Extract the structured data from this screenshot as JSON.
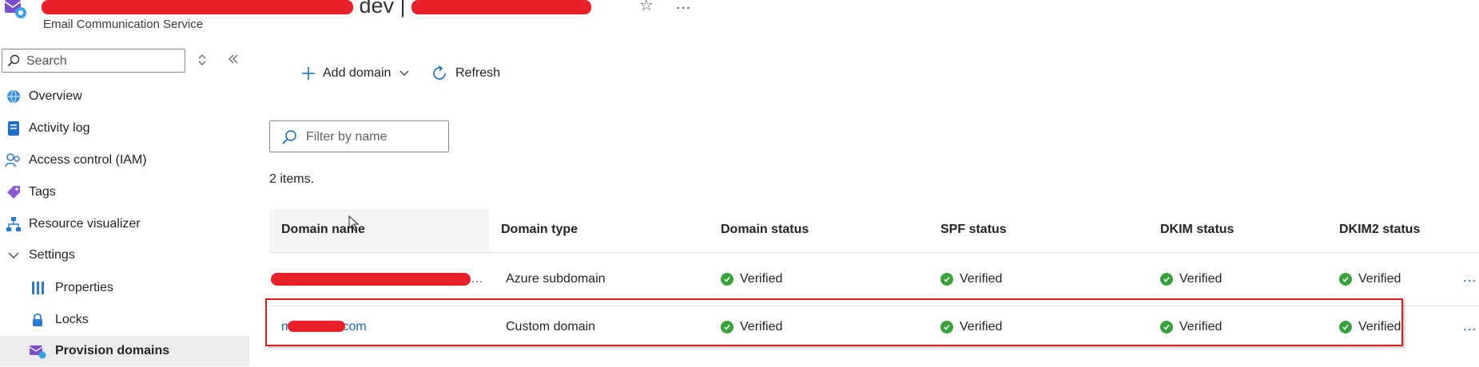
{
  "header": {
    "title_visible_fragment": "dev |",
    "subtitle": "Email Communication Service"
  },
  "sidebar": {
    "search_placeholder": "Search",
    "items": [
      {
        "label": "Overview",
        "icon": "globe-icon"
      },
      {
        "label": "Activity log",
        "icon": "activity-log-icon"
      },
      {
        "label": "Access control (IAM)",
        "icon": "people-icon"
      },
      {
        "label": "Tags",
        "icon": "tag-icon"
      },
      {
        "label": "Resource visualizer",
        "icon": "hierarchy-icon"
      },
      {
        "label": "Settings",
        "icon": "chevron-down-icon"
      },
      {
        "label": "Properties",
        "icon": "properties-icon"
      },
      {
        "label": "Locks",
        "icon": "lock-icon"
      },
      {
        "label": "Provision domains",
        "icon": "provision-domains-icon"
      }
    ]
  },
  "toolbar": {
    "add_domain_label": "Add domain",
    "refresh_label": "Refresh"
  },
  "filter": {
    "placeholder": "Filter by name"
  },
  "table": {
    "count_text": "2 items.",
    "headers": [
      "Domain name",
      "Domain type",
      "Domain status",
      "SPF status",
      "DKIM status",
      "DKIM2 status"
    ],
    "rows": [
      {
        "domain_name": "…",
        "domain_type": "Azure subdomain",
        "domain_status": "Verified",
        "spf": "Verified",
        "dkim": "Verified",
        "dkim2": "Verified"
      },
      {
        "domain_name": "m          re.com",
        "domain_type": "Custom domain",
        "domain_status": "Verified",
        "spf": "Verified",
        "dkim": "Verified",
        "dkim2": "Verified"
      }
    ]
  },
  "colors": {
    "accent": "#0f6cbd",
    "verified": "#37a33a",
    "highlight": "#e01c1c"
  }
}
